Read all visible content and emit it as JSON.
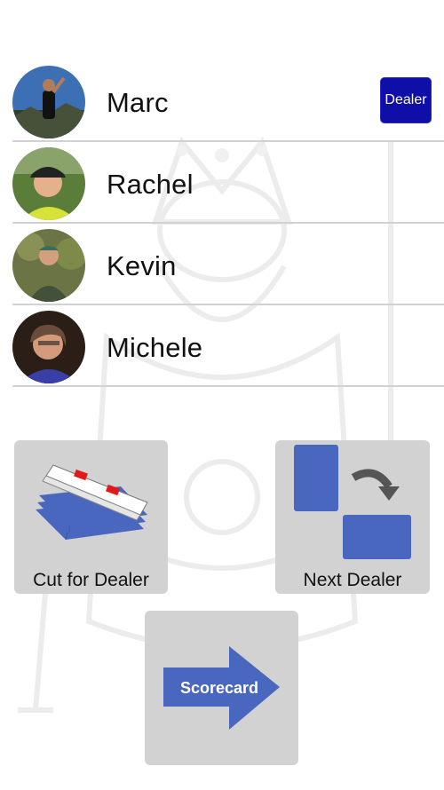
{
  "players": [
    {
      "name": "Marc",
      "is_dealer": true
    },
    {
      "name": "Rachel",
      "is_dealer": false
    },
    {
      "name": "Kevin",
      "is_dealer": false
    },
    {
      "name": "Michele",
      "is_dealer": false
    }
  ],
  "dealer_badge_label": "Dealer",
  "actions": {
    "cut_for_dealer_label": "Cut for Dealer",
    "next_dealer_label": "Next Dealer",
    "scorecard_label": "Scorecard"
  },
  "colors": {
    "accent_blue": "#4a67bf",
    "dealer_badge": "#0f0ea8",
    "tile_gray": "#d2d2d2",
    "card_red": "#e0191b"
  }
}
